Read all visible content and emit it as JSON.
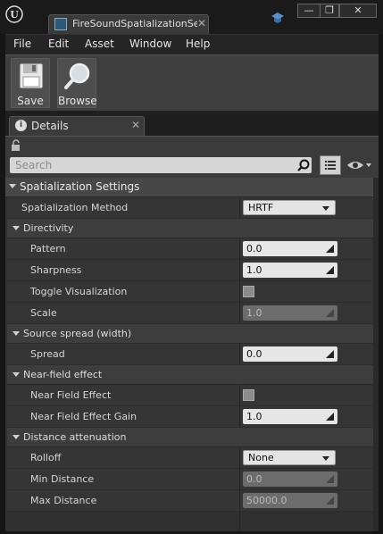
{
  "window": {
    "tab_title": "FireSoundSpatializationSe",
    "minimize": "—",
    "maximize": "❐",
    "close": "✕"
  },
  "menu": [
    "File",
    "Edit",
    "Asset",
    "Window",
    "Help"
  ],
  "toolbar": {
    "save_label": "Save",
    "browse_label": "Browse"
  },
  "details": {
    "tab_label": "Details",
    "search_placeholder": "Search",
    "sections": [
      {
        "label": "Spatialization Settings"
      }
    ],
    "properties": {
      "spatialization_method": {
        "label": "Spatialization Method",
        "value": "HRTF"
      },
      "directivity": "Directivity",
      "pattern": {
        "label": "Pattern",
        "value": "0.0"
      },
      "sharpness": {
        "label": "Sharpness",
        "value": "1.0"
      },
      "toggle_visualization": {
        "label": "Toggle Visualization"
      },
      "scale": {
        "label": "Scale",
        "value": "1.0"
      },
      "source_spread": "Source spread (width)",
      "spread": {
        "label": "Spread",
        "value": "0.0"
      },
      "near_field": "Near-field effect",
      "near_field_effect": {
        "label": "Near Field Effect"
      },
      "near_field_gain": {
        "label": "Near Field Effect Gain",
        "value": "1.0"
      },
      "distance_attenuation": "Distance attenuation",
      "rolloff": {
        "label": "Rolloff",
        "value": "None"
      },
      "min_distance": {
        "label": "Min Distance",
        "value": "0.0"
      },
      "max_distance": {
        "label": "Max Distance",
        "value": "50000.0"
      }
    }
  },
  "colors": {
    "accent": "#e6e6e6",
    "panel": "#3b3b3b",
    "category": "#474747"
  },
  "icons": [
    "unreal-logo-icon",
    "sound-asset-icon",
    "learn-hat-icon",
    "save-disk-icon",
    "browse-magnifier-icon",
    "details-info-icon",
    "lock-icon",
    "search-icon",
    "view-options-icon",
    "eye-icon"
  ]
}
